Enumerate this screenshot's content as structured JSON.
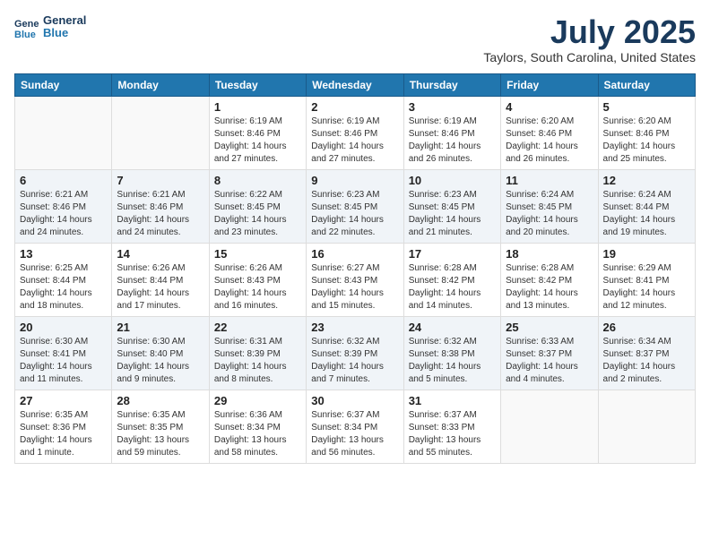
{
  "header": {
    "logo_line1": "General",
    "logo_line2": "Blue",
    "month": "July 2025",
    "location": "Taylors, South Carolina, United States"
  },
  "days_of_week": [
    "Sunday",
    "Monday",
    "Tuesday",
    "Wednesday",
    "Thursday",
    "Friday",
    "Saturday"
  ],
  "weeks": [
    [
      {
        "day": "",
        "text": ""
      },
      {
        "day": "",
        "text": ""
      },
      {
        "day": "1",
        "text": "Sunrise: 6:19 AM\nSunset: 8:46 PM\nDaylight: 14 hours and 27 minutes."
      },
      {
        "day": "2",
        "text": "Sunrise: 6:19 AM\nSunset: 8:46 PM\nDaylight: 14 hours and 27 minutes."
      },
      {
        "day": "3",
        "text": "Sunrise: 6:19 AM\nSunset: 8:46 PM\nDaylight: 14 hours and 26 minutes."
      },
      {
        "day": "4",
        "text": "Sunrise: 6:20 AM\nSunset: 8:46 PM\nDaylight: 14 hours and 26 minutes."
      },
      {
        "day": "5",
        "text": "Sunrise: 6:20 AM\nSunset: 8:46 PM\nDaylight: 14 hours and 25 minutes."
      }
    ],
    [
      {
        "day": "6",
        "text": "Sunrise: 6:21 AM\nSunset: 8:46 PM\nDaylight: 14 hours and 24 minutes."
      },
      {
        "day": "7",
        "text": "Sunrise: 6:21 AM\nSunset: 8:46 PM\nDaylight: 14 hours and 24 minutes."
      },
      {
        "day": "8",
        "text": "Sunrise: 6:22 AM\nSunset: 8:45 PM\nDaylight: 14 hours and 23 minutes."
      },
      {
        "day": "9",
        "text": "Sunrise: 6:23 AM\nSunset: 8:45 PM\nDaylight: 14 hours and 22 minutes."
      },
      {
        "day": "10",
        "text": "Sunrise: 6:23 AM\nSunset: 8:45 PM\nDaylight: 14 hours and 21 minutes."
      },
      {
        "day": "11",
        "text": "Sunrise: 6:24 AM\nSunset: 8:45 PM\nDaylight: 14 hours and 20 minutes."
      },
      {
        "day": "12",
        "text": "Sunrise: 6:24 AM\nSunset: 8:44 PM\nDaylight: 14 hours and 19 minutes."
      }
    ],
    [
      {
        "day": "13",
        "text": "Sunrise: 6:25 AM\nSunset: 8:44 PM\nDaylight: 14 hours and 18 minutes."
      },
      {
        "day": "14",
        "text": "Sunrise: 6:26 AM\nSunset: 8:44 PM\nDaylight: 14 hours and 17 minutes."
      },
      {
        "day": "15",
        "text": "Sunrise: 6:26 AM\nSunset: 8:43 PM\nDaylight: 14 hours and 16 minutes."
      },
      {
        "day": "16",
        "text": "Sunrise: 6:27 AM\nSunset: 8:43 PM\nDaylight: 14 hours and 15 minutes."
      },
      {
        "day": "17",
        "text": "Sunrise: 6:28 AM\nSunset: 8:42 PM\nDaylight: 14 hours and 14 minutes."
      },
      {
        "day": "18",
        "text": "Sunrise: 6:28 AM\nSunset: 8:42 PM\nDaylight: 14 hours and 13 minutes."
      },
      {
        "day": "19",
        "text": "Sunrise: 6:29 AM\nSunset: 8:41 PM\nDaylight: 14 hours and 12 minutes."
      }
    ],
    [
      {
        "day": "20",
        "text": "Sunrise: 6:30 AM\nSunset: 8:41 PM\nDaylight: 14 hours and 11 minutes."
      },
      {
        "day": "21",
        "text": "Sunrise: 6:30 AM\nSunset: 8:40 PM\nDaylight: 14 hours and 9 minutes."
      },
      {
        "day": "22",
        "text": "Sunrise: 6:31 AM\nSunset: 8:39 PM\nDaylight: 14 hours and 8 minutes."
      },
      {
        "day": "23",
        "text": "Sunrise: 6:32 AM\nSunset: 8:39 PM\nDaylight: 14 hours and 7 minutes."
      },
      {
        "day": "24",
        "text": "Sunrise: 6:32 AM\nSunset: 8:38 PM\nDaylight: 14 hours and 5 minutes."
      },
      {
        "day": "25",
        "text": "Sunrise: 6:33 AM\nSunset: 8:37 PM\nDaylight: 14 hours and 4 minutes."
      },
      {
        "day": "26",
        "text": "Sunrise: 6:34 AM\nSunset: 8:37 PM\nDaylight: 14 hours and 2 minutes."
      }
    ],
    [
      {
        "day": "27",
        "text": "Sunrise: 6:35 AM\nSunset: 8:36 PM\nDaylight: 14 hours and 1 minute."
      },
      {
        "day": "28",
        "text": "Sunrise: 6:35 AM\nSunset: 8:35 PM\nDaylight: 13 hours and 59 minutes."
      },
      {
        "day": "29",
        "text": "Sunrise: 6:36 AM\nSunset: 8:34 PM\nDaylight: 13 hours and 58 minutes."
      },
      {
        "day": "30",
        "text": "Sunrise: 6:37 AM\nSunset: 8:34 PM\nDaylight: 13 hours and 56 minutes."
      },
      {
        "day": "31",
        "text": "Sunrise: 6:37 AM\nSunset: 8:33 PM\nDaylight: 13 hours and 55 minutes."
      },
      {
        "day": "",
        "text": ""
      },
      {
        "day": "",
        "text": ""
      }
    ]
  ]
}
